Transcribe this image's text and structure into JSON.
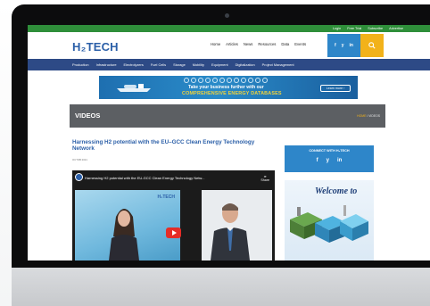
{
  "topbar": {
    "links": [
      "Login",
      "Free Trial",
      "Subscribe",
      "Advertise"
    ]
  },
  "header": {
    "logo": "H₂TECH",
    "nav": [
      "Home",
      "Articles",
      "News",
      "Resources",
      "Data",
      "Events"
    ],
    "social_icons": [
      "f",
      "y",
      "in"
    ]
  },
  "categories": [
    "Production",
    "Infrastructure",
    "Electrolyzers",
    "Fuel Cells",
    "Storage",
    "Mobility",
    "Equipment",
    "Digitalization",
    "Project Management"
  ],
  "banner": {
    "line1": "Take your business further with our",
    "line2": "COMPREHENSIVE ENERGY DATABASES",
    "cta": "Learn more ›"
  },
  "section": {
    "title": "VIDEOS",
    "breadcrumb_home": "HOME",
    "breadcrumb_sep": " / ",
    "breadcrumb_current": "VIDEOS"
  },
  "article": {
    "headline": "Harnessing H2 potential with the EU–GCC Clean Energy Technology Network",
    "date": "OCTOB 2021",
    "video_title": "Harnessing H2 potential with the EU-GCC Clean Energy Technology Netw...",
    "video_share": "Share",
    "video_watermark": "H₂TECH"
  },
  "sidebar": {
    "connect_title": "CONNECT WITH H₂TECH",
    "connect_icons": [
      "f",
      "y",
      "in"
    ],
    "ad_headline": "Welcome to"
  },
  "colors": {
    "top_strip": "#2f8f3a",
    "brand_blue": "#2b5fa8",
    "category_bar": "#2d4a86",
    "social": "#2e86c9",
    "search": "#f2b21a",
    "videos_band": "#5c5f63",
    "play_button": "#e52d27"
  },
  "icons": {
    "search": "search-icon",
    "play": "play-icon",
    "share": "share-icon",
    "camera": "camera-icon"
  }
}
